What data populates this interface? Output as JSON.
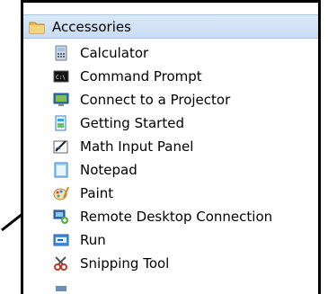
{
  "folder": {
    "label": "Accessories"
  },
  "items": [
    {
      "label": "Calculator",
      "icon": "calculator-icon"
    },
    {
      "label": "Command Prompt",
      "icon": "command-prompt-icon"
    },
    {
      "label": "Connect to a Projector",
      "icon": "projector-icon"
    },
    {
      "label": "Getting Started",
      "icon": "getting-started-icon"
    },
    {
      "label": "Math Input Panel",
      "icon": "math-input-icon"
    },
    {
      "label": "Notepad",
      "icon": "notepad-icon"
    },
    {
      "label": "Paint",
      "icon": "paint-icon"
    },
    {
      "label": "Remote Desktop Connection",
      "icon": "remote-desktop-icon"
    },
    {
      "label": "Run",
      "icon": "run-icon"
    },
    {
      "label": "Snipping Tool",
      "icon": "snipping-tool-icon"
    }
  ],
  "icons": {
    "folder": "folder-icon",
    "pointer": "pointer-arrow"
  }
}
